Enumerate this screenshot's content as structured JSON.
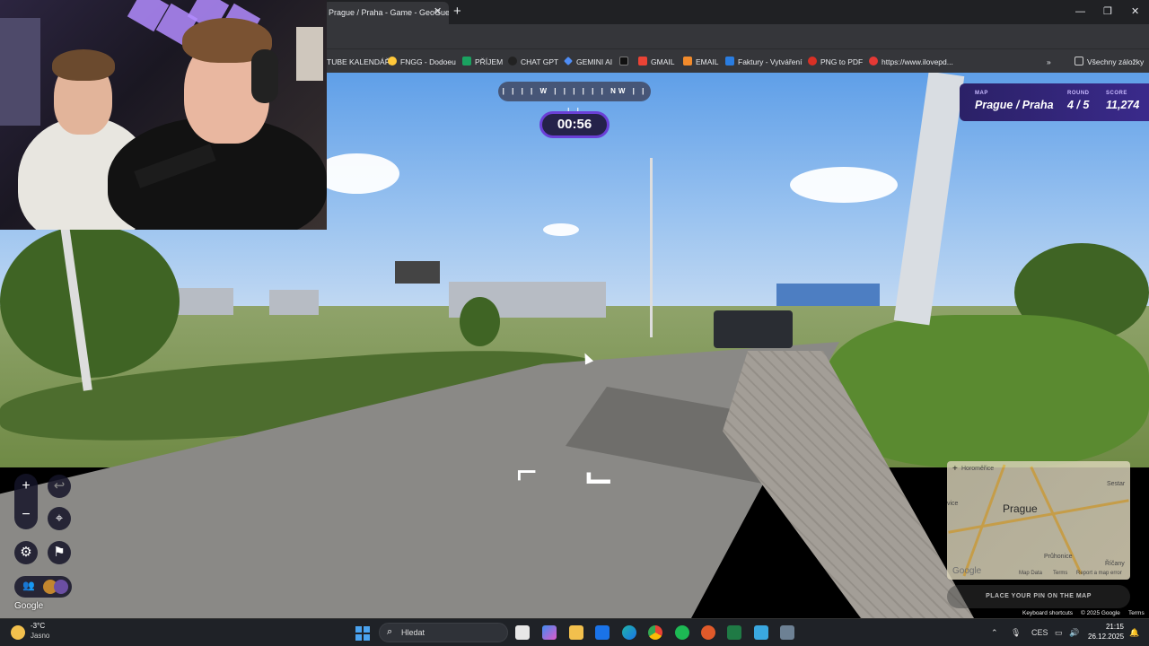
{
  "browser": {
    "tab_title": "Prague / Praha - Game - GeoGuessr",
    "bookmarks": [
      {
        "label": "TUBE KALENDÁŘ",
        "color": "#ff0000"
      },
      {
        "label": "FNGG - Dodoeu",
        "color": "#ffc83a"
      },
      {
        "label": "PŘÍJEM",
        "color": "#1aa260"
      },
      {
        "label": "CHAT GPT",
        "color": "#222222"
      },
      {
        "label": "GEMINI AI",
        "color": "#4f8df5"
      },
      {
        "label": "",
        "color": "#111111"
      },
      {
        "label": "GMAIL",
        "color": "#ea4335"
      },
      {
        "label": "EMAIL",
        "color": "#f28b2c"
      },
      {
        "label": "Faktury - Vytváření",
        "color": "#2a7de1"
      },
      {
        "label": "PNG to PDF",
        "color": "#d93025"
      },
      {
        "label": "https://www.ilovepd...",
        "color": "#e53935"
      }
    ],
    "all_bookmarks": "Všechny záložky"
  },
  "game": {
    "compass": {
      "dir1": "W",
      "dir2": "NW"
    },
    "timer": "00:56",
    "status": {
      "map_label": "MAP",
      "map_value": "Prague / Praha",
      "round_label": "ROUND",
      "round_value": "4 / 5",
      "score_label": "SCORE",
      "score_value": "11,274"
    },
    "minimap": {
      "city": "Prague",
      "labels": [
        "Horoměřice",
        "Sestar",
        "Průhonice",
        "Říčany",
        "vice"
      ],
      "attribution": [
        "Map Data",
        "Terms",
        "Report a map error"
      ],
      "google": "Google"
    },
    "guess_button": "PLACE YOUR PIN ON THE MAP",
    "google_logo": "Google",
    "footer": [
      "Keyboard shortcuts",
      "© 2025 Google",
      "Terms"
    ]
  },
  "taskbar": {
    "weather_temp": "-3°C",
    "weather_cond": "Jasno",
    "search_placeholder": "Hledat",
    "language": "CES",
    "time": "21:15",
    "date": "26.12.2025"
  },
  "colors": {
    "accent": "#6a3fd6",
    "status_bg": "#2b2167"
  }
}
